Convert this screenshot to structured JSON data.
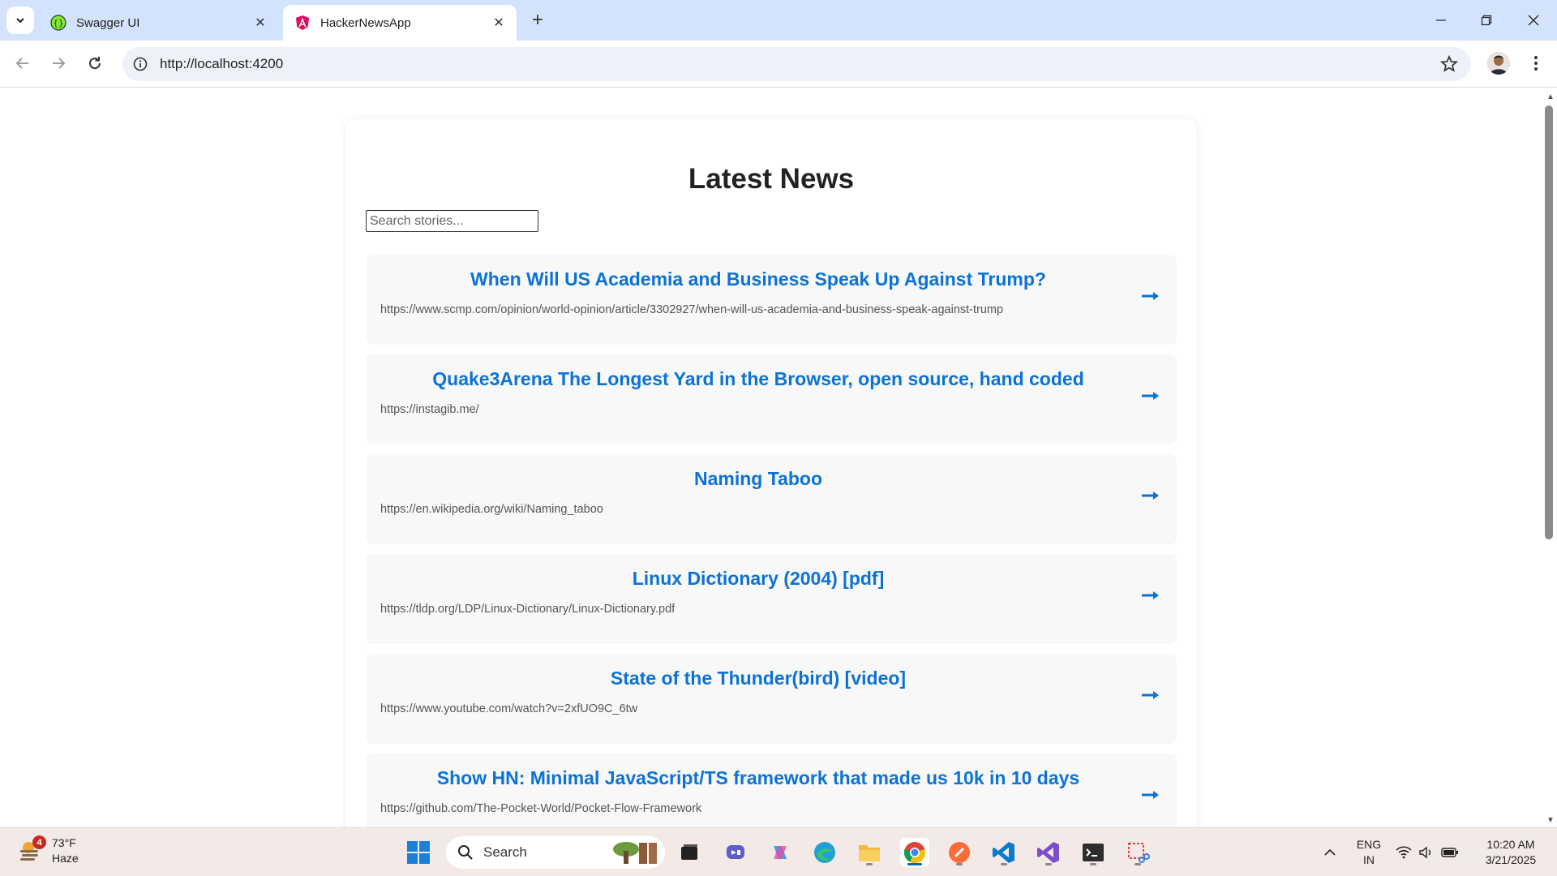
{
  "browser": {
    "tabs": [
      {
        "title": "Swagger UI",
        "active": false
      },
      {
        "title": "HackerNewsApp",
        "active": true
      }
    ],
    "url": "http://localhost:4200"
  },
  "page": {
    "heading": "Latest News",
    "search_placeholder": "Search stories...",
    "accent_color": "#0b72d6",
    "stories": [
      {
        "title": "When Will US Academia and Business Speak Up Against Trump?",
        "url": "https://www.scmp.com/opinion/world-opinion/article/3302927/when-will-us-academia-and-business-speak-against-trump"
      },
      {
        "title": "Quake3Arena The Longest Yard in the Browser, open source, hand coded",
        "url": "https://instagib.me/"
      },
      {
        "title": "Naming Taboo",
        "url": "https://en.wikipedia.org/wiki/Naming_taboo"
      },
      {
        "title": "Linux Dictionary (2004) [pdf]",
        "url": "https://tldp.org/LDP/Linux-Dictionary/Linux-Dictionary.pdf"
      },
      {
        "title": "State of the Thunder(bird) [video]",
        "url": "https://www.youtube.com/watch?v=2xfUO9C_6tw"
      },
      {
        "title": "Show HN: Minimal JavaScript/TS framework that made us 10k in 10 days",
        "url": "https://github.com/The-Pocket-World/Pocket-Flow-Framework"
      }
    ]
  },
  "taskbar": {
    "weather_temp": "73°F",
    "weather_desc": "Haze",
    "weather_badge": "4",
    "search_label": "Search",
    "language_top": "ENG",
    "language_bottom": "IN",
    "time": "10:20 AM",
    "date": "3/21/2025"
  }
}
